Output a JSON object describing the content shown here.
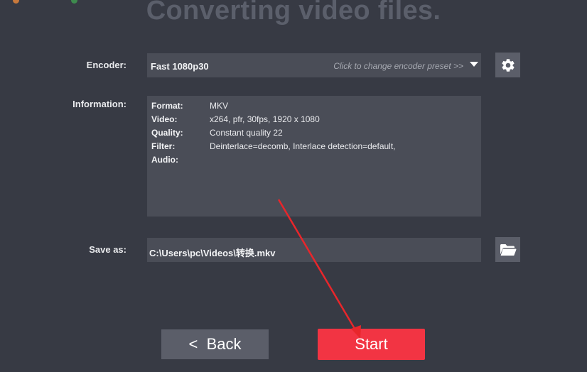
{
  "page": {
    "title": "Converting video files."
  },
  "encoder": {
    "label": "Encoder:",
    "value": "Fast 1080p30",
    "hint": "Click to change encoder preset >>",
    "settings_icon": "gear-icon"
  },
  "information": {
    "label": "Information:",
    "rows": [
      {
        "key": "Format:",
        "value": "MKV"
      },
      {
        "key": "Video:",
        "value": "x264, pfr, 30fps, 1920 x 1080"
      },
      {
        "key": "Quality:",
        "value": "Constant quality 22"
      },
      {
        "key": "Filter:",
        "value": "Deinterlace=decomb, Interlace detection=default,"
      },
      {
        "key": "Audio:",
        "value": ""
      }
    ]
  },
  "save_as": {
    "label": "Save as:",
    "value": "C:\\Users\\pc\\Videos\\转换.mkv",
    "browse_icon": "folder-icon"
  },
  "buttons": {
    "back": "<  Back",
    "start": "Start"
  },
  "colors": {
    "background": "#373a44",
    "field": "#4a4d57",
    "icon_button": "#5b5e69",
    "start_button": "#f23443",
    "annotation_arrow": "#e8262b"
  }
}
